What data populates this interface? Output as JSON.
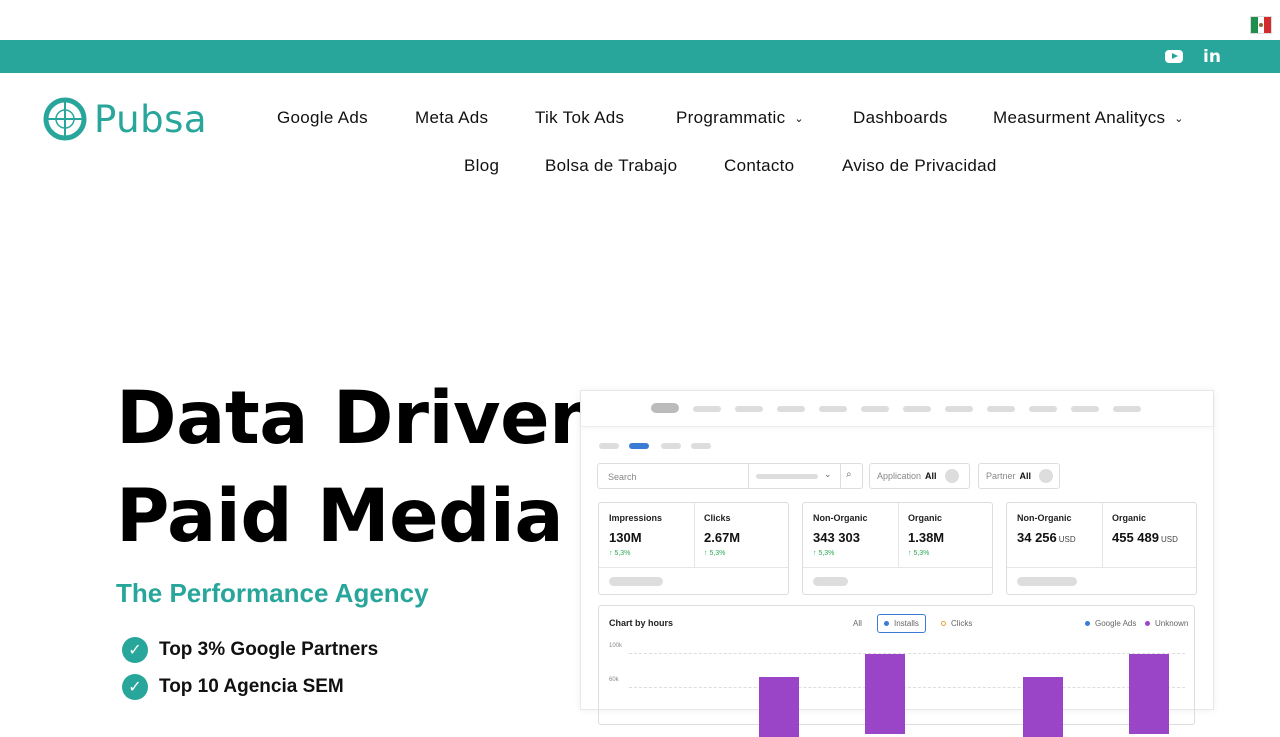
{
  "social": {
    "youtube_icon": "youtube-icon",
    "linkedin_glyph": "in"
  },
  "brand": {
    "name": "Pubsa",
    "color": "#29a69b"
  },
  "nav": {
    "items": [
      {
        "label": "Google Ads"
      },
      {
        "label": "Meta Ads"
      },
      {
        "label": "Tik Tok Ads"
      },
      {
        "label": "Programmatic",
        "chevron": "⌄"
      },
      {
        "label": "Dashboards"
      },
      {
        "label": "Measurment Analitycs",
        "chevron": "⌄"
      },
      {
        "label": "Blog"
      },
      {
        "label": "Bolsa de Trabajo"
      },
      {
        "label": "Contacto"
      },
      {
        "label": "Aviso de Privacidad"
      }
    ]
  },
  "hero": {
    "title_line1": "Data Driven",
    "title_line2": "Paid Media",
    "subtitle": "The Performance Agency",
    "checks": [
      "Top 3% Google Partners",
      "Top 10 Agencia SEM"
    ]
  },
  "dashboard": {
    "search_placeholder": "Search",
    "filter_application": {
      "label": "Application",
      "value": "All"
    },
    "filter_partner": {
      "label": "Partner",
      "value": "All"
    },
    "cards": [
      {
        "m1": {
          "label": "Impressions",
          "value": "130M",
          "change": "↑ 5,3%"
        },
        "m2": {
          "label": "Clicks",
          "value": "2.67M",
          "change": "↑ 5,3%"
        }
      },
      {
        "m1": {
          "label": "Non-Organic",
          "value": "343 303",
          "change": "↑ 5,3%"
        },
        "m2": {
          "label": "Organic",
          "value": "1.38M",
          "change": "↑ 5,3%"
        }
      },
      {
        "m1": {
          "label": "Non-Organic",
          "value": "34 256",
          "unit": "USD"
        },
        "m2": {
          "label": "Organic",
          "value": "455 489",
          "unit": "USD"
        }
      }
    ],
    "chart": {
      "title": "Chart by hours",
      "options": [
        "All",
        "Installs",
        "Clicks"
      ],
      "legend": [
        "Google Ads",
        "Unknown"
      ],
      "y_ticks": [
        "100k",
        "60k"
      ],
      "bar_color": "#9a45c8",
      "legend_colors": {
        "installs": "#3a7bd5",
        "clicks": "#e8a33a",
        "google_ads": "#3a7bd5",
        "unknown": "#9a45c8"
      }
    }
  }
}
